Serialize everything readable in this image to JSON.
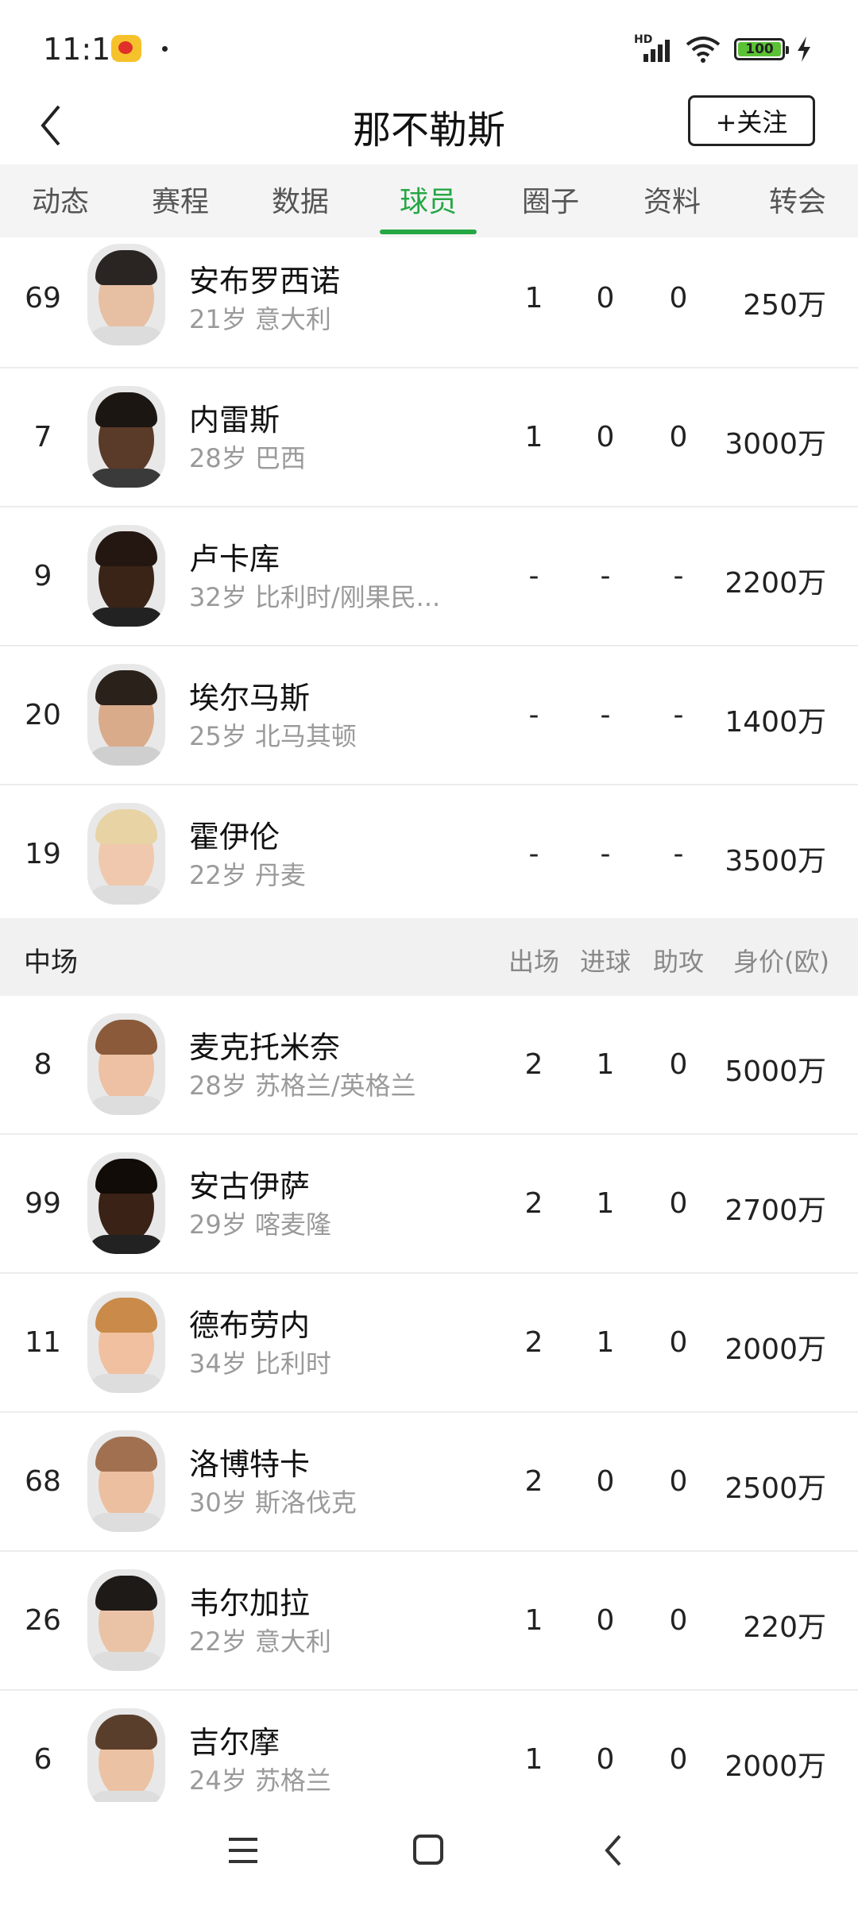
{
  "status_bar": {
    "time": "11:12",
    "hd": "HD",
    "battery": "100"
  },
  "header": {
    "title": "那不勒斯",
    "follow_label": "+关注"
  },
  "tabs": [
    {
      "label": "动态"
    },
    {
      "label": "赛程"
    },
    {
      "label": "数据"
    },
    {
      "label": "球员",
      "active": true
    },
    {
      "label": "圈子"
    },
    {
      "label": "资料"
    },
    {
      "label": "转会"
    }
  ],
  "forwards": [
    {
      "number": "69",
      "name": "安布罗西诺",
      "info": "21岁 意大利",
      "apps": "1",
      "goals": "0",
      "assists": "0",
      "value": "250万"
    },
    {
      "number": "7",
      "name": "内雷斯",
      "info": "28岁 巴西",
      "apps": "1",
      "goals": "0",
      "assists": "0",
      "value": "3000万"
    },
    {
      "number": "9",
      "name": "卢卡库",
      "info": "32岁 比利时/刚果民...",
      "apps": "-",
      "goals": "-",
      "assists": "-",
      "value": "2200万"
    },
    {
      "number": "20",
      "name": "埃尔马斯",
      "info": "25岁 北马其顿",
      "apps": "-",
      "goals": "-",
      "assists": "-",
      "value": "1400万"
    },
    {
      "number": "19",
      "name": "霍伊伦",
      "info": "22岁 丹麦",
      "apps": "-",
      "goals": "-",
      "assists": "-",
      "value": "3500万"
    }
  ],
  "midfield_section": {
    "title": "中场",
    "col_apps": "出场",
    "col_goals": "进球",
    "col_assists": "助攻",
    "col_value": "身价(欧)"
  },
  "midfielders": [
    {
      "number": "8",
      "name": "麦克托米奈",
      "info": "28岁 苏格兰/英格兰",
      "apps": "2",
      "goals": "1",
      "assists": "0",
      "value": "5000万"
    },
    {
      "number": "99",
      "name": "安古伊萨",
      "info": "29岁 喀麦隆",
      "apps": "2",
      "goals": "1",
      "assists": "0",
      "value": "2700万"
    },
    {
      "number": "11",
      "name": "德布劳内",
      "info": "34岁 比利时",
      "apps": "2",
      "goals": "1",
      "assists": "0",
      "value": "2000万"
    },
    {
      "number": "68",
      "name": "洛博特卡",
      "info": "30岁 斯洛伐克",
      "apps": "2",
      "goals": "0",
      "assists": "0",
      "value": "2500万"
    },
    {
      "number": "26",
      "name": "韦尔加拉",
      "info": "22岁 意大利",
      "apps": "1",
      "goals": "0",
      "assists": "0",
      "value": "220万"
    },
    {
      "number": "6",
      "name": "吉尔摩",
      "info": "24岁 苏格兰",
      "apps": "1",
      "goals": "0",
      "assists": "0",
      "value": "2000万"
    }
  ],
  "colors": {
    "accent": "#25a744",
    "muted_text": "#9a9a9a",
    "section_bg": "#f1f1f1"
  }
}
